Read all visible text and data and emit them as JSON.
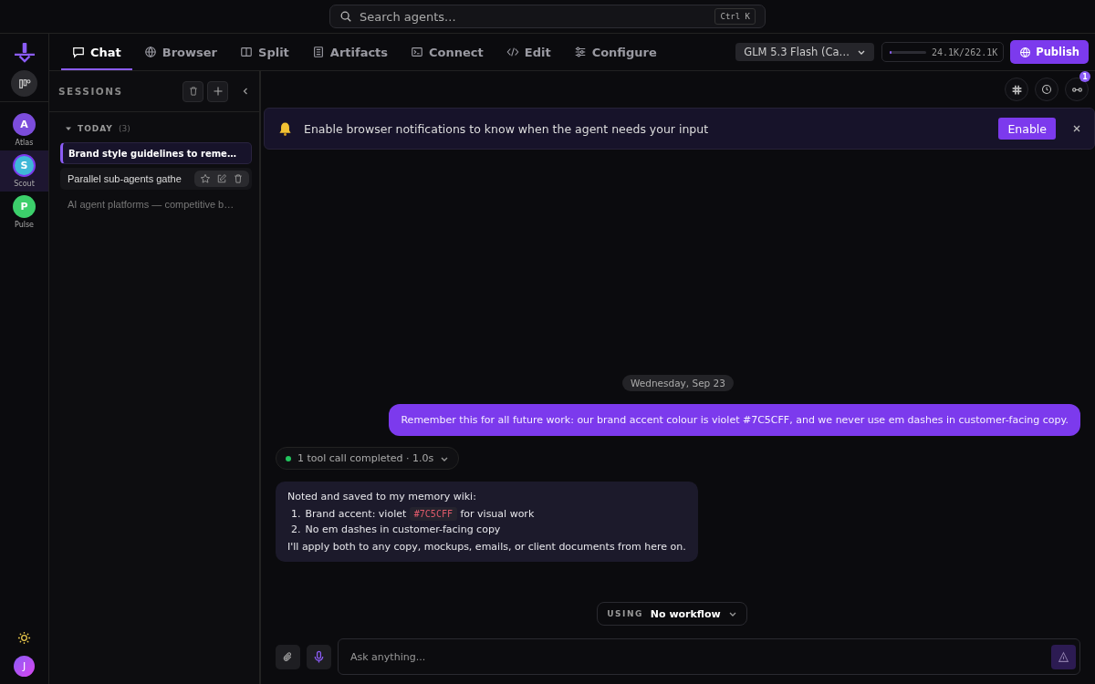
{
  "search": {
    "placeholder": "Search agents...",
    "shortcut": "Ctrl K"
  },
  "agents": [
    {
      "initial": "A",
      "name": "Atlas",
      "color": "#7c4ddb",
      "selected": false
    },
    {
      "initial": "S",
      "name": "Scout",
      "color": "#3fb8d8",
      "selected": true
    },
    {
      "initial": "P",
      "name": "Pulse",
      "color": "#3ccf6b",
      "selected": false
    }
  ],
  "user": {
    "initial": "J"
  },
  "tabs": [
    {
      "label": "Chat",
      "selected": true
    },
    {
      "label": "Browser",
      "selected": false
    },
    {
      "label": "Split",
      "selected": false
    },
    {
      "label": "Artifacts",
      "selected": false
    },
    {
      "label": "Connect",
      "selected": false
    },
    {
      "label": "Edit",
      "selected": false
    },
    {
      "label": "Configure",
      "selected": false
    }
  ],
  "model": {
    "label": "GLM 5.3 Flash (Ca…"
  },
  "context": {
    "level": 0.06,
    "reading": "24.1K/262.1K"
  },
  "publish": {
    "label": "Publish"
  },
  "sessions": {
    "title": "SESSIONS",
    "group": {
      "label": "TODAY",
      "count": "(3)",
      "expanded": true
    },
    "items": [
      {
        "title": "Brand style guidelines to reme…",
        "selected": true,
        "hovered": false
      },
      {
        "title": "Parallel sub-agents gathe",
        "selected": false,
        "hovered": true
      },
      {
        "title": "AI agent platforms — competitive b…",
        "selected": false,
        "hovered": false
      }
    ]
  },
  "toolbar": {
    "badge": "1"
  },
  "banner": {
    "text": "Enable browser notifications to know when the agent needs your input",
    "button": "Enable"
  },
  "date": "Wednesday, Sep 23",
  "messages": [
    {
      "kind": "user",
      "text": "Remember this for all future work: our brand accent colour is violet #7C5CFF, and we never use em dashes in customer-facing copy."
    },
    {
      "kind": "tool",
      "text": "1 tool call completed · 1.0s",
      "color": "#22c55e"
    },
    {
      "kind": "assistant",
      "intro": "Noted and saved to my memory wiki:",
      "items": [
        {
          "number": "1.",
          "parts": [
            {
              "kind": "text",
              "text": "Brand accent: violet"
            },
            {
              "kind": "code",
              "text": "#7C5CFF"
            },
            {
              "kind": "text",
              "text": "for visual work"
            }
          ]
        },
        {
          "number": "2.",
          "parts": [
            {
              "kind": "text",
              "text": "No em dashes in customer-facing copy"
            }
          ]
        }
      ],
      "outro": "I'll apply both to any copy, mockups, emails, or client documents from here on."
    }
  ],
  "workflow": {
    "label": "USING",
    "value": "No workflow"
  },
  "composer": {
    "placeholder": "Ask anything..."
  }
}
